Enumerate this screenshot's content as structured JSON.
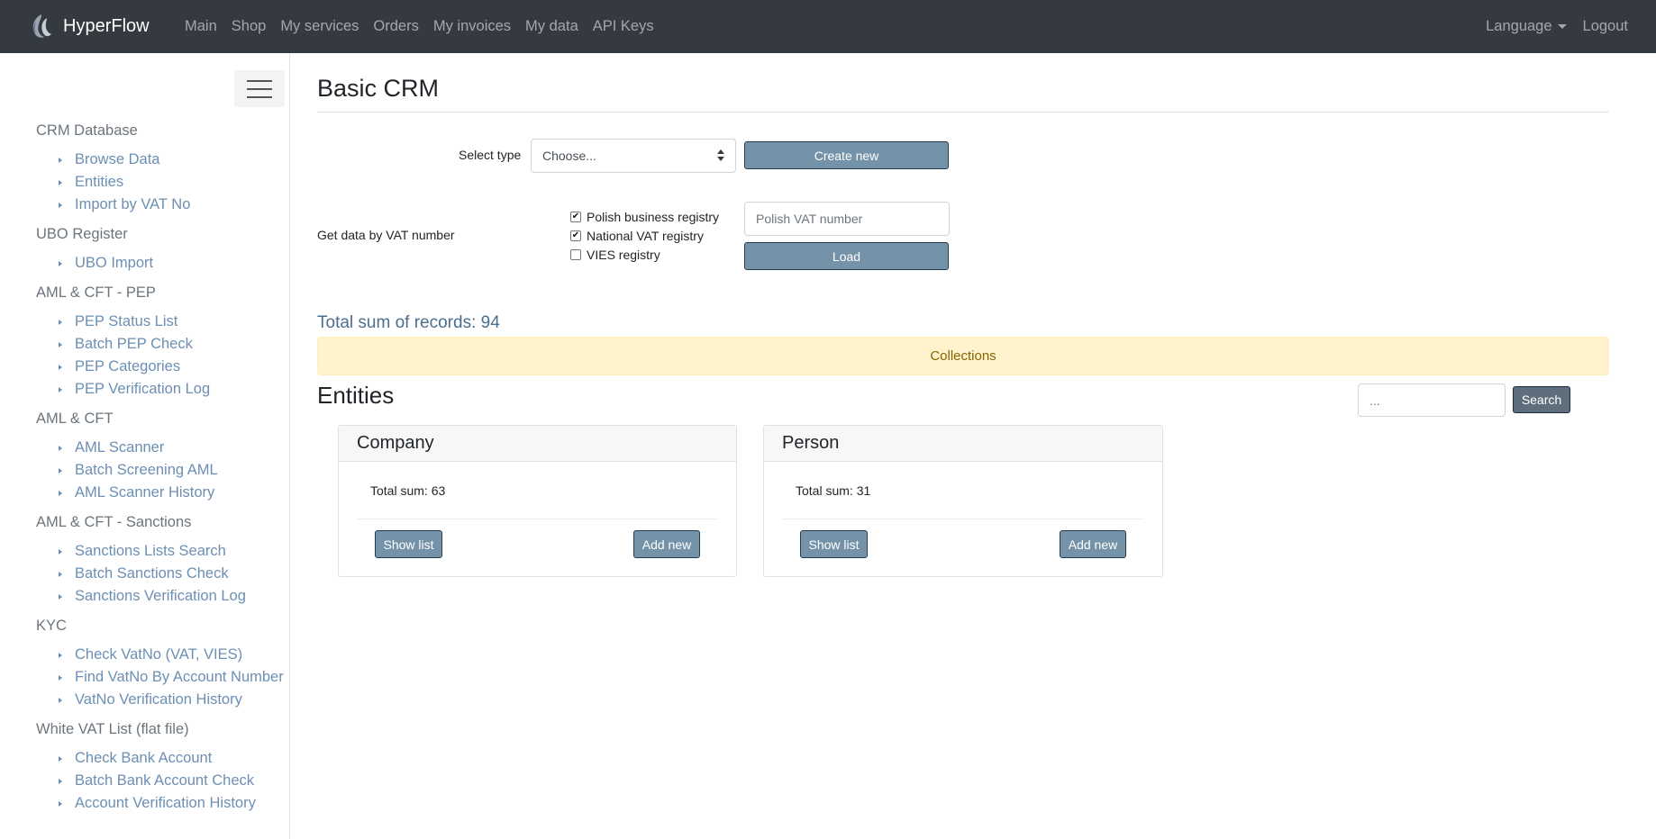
{
  "brand": {
    "name": "HyperFlow"
  },
  "nav": {
    "links": [
      "Main",
      "Shop",
      "My services",
      "Orders",
      "My invoices",
      "My data",
      "API Keys"
    ],
    "language": "Language",
    "logout": "Logout"
  },
  "sidebar": {
    "groups": [
      {
        "title": "CRM Database",
        "items": [
          "Browse Data",
          "Entities",
          "Import by VAT No"
        ]
      },
      {
        "title": "UBO Register",
        "items": [
          "UBO Import"
        ]
      },
      {
        "title": "AML & CFT - PEP",
        "items": [
          "PEP Status List",
          "Batch PEP Check",
          "PEP Categories",
          "PEP Verification Log"
        ]
      },
      {
        "title": "AML & CFT",
        "items": [
          "AML Scanner",
          "Batch Screening AML",
          "AML Scanner History"
        ]
      },
      {
        "title": "AML & CFT - Sanctions",
        "items": [
          "Sanctions Lists Search",
          "Batch Sanctions Check",
          "Sanctions Verification Log"
        ]
      },
      {
        "title": "KYC",
        "items": [
          "Check VatNo (VAT, VIES)",
          "Find VatNo By Account Number",
          "VatNo Verification History"
        ]
      },
      {
        "title": "White VAT List (flat file)",
        "items": [
          "Check Bank Account",
          "Batch Bank Account Check",
          "Account Verification History"
        ]
      }
    ]
  },
  "main": {
    "title": "Basic CRM",
    "select_type_label": "Select type",
    "select_value": "Choose...",
    "create_new": "Create new",
    "vat_label": "Get data by VAT number",
    "checks": [
      {
        "label": "Polish business registry",
        "checked": true
      },
      {
        "label": "National VAT registry",
        "checked": true
      },
      {
        "label": "VIES registry",
        "checked": false
      }
    ],
    "vat_placeholder": "Polish VAT number",
    "load": "Load",
    "total_records": "Total sum of records: 94",
    "collections": "Collections",
    "entities_title": "Entities",
    "search_placeholder": "...",
    "search_button": "Search",
    "cards": [
      {
        "title": "Company",
        "total": "Total sum: 63",
        "show": "Show list",
        "add": "Add new"
      },
      {
        "title": "Person",
        "total": "Total sum: 31",
        "show": "Show list",
        "add": "Add new"
      }
    ]
  }
}
